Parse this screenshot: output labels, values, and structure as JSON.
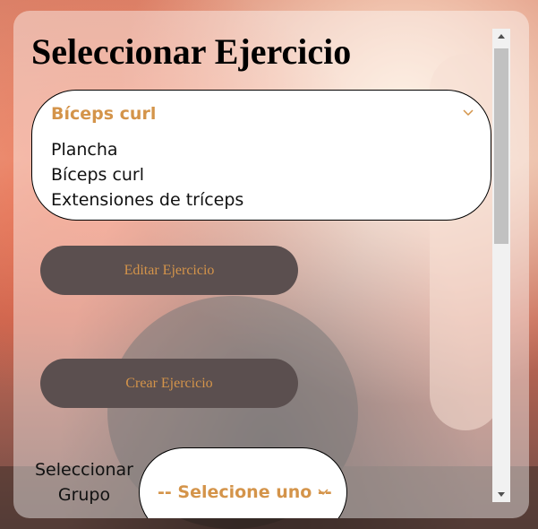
{
  "page": {
    "title": "Seleccionar Ejercicio"
  },
  "exercise_select": {
    "selected": "Bíceps curl",
    "options": [
      "Plancha",
      "Bíceps curl",
      "Extensiones de tríceps"
    ]
  },
  "buttons": {
    "edit_label": "Editar Ejercicio",
    "create_label": "Crear Ejercicio"
  },
  "group": {
    "label": "Seleccionar Grupo",
    "selected": "-- Selecione uno --"
  },
  "colors": {
    "accent": "#d4944a",
    "button_bg": "#5b4f4f"
  },
  "icons": {
    "dropdown": "chevron-down-icon",
    "scroll_up": "scroll-up-arrow-icon",
    "scroll_down": "scroll-down-arrow-icon"
  }
}
